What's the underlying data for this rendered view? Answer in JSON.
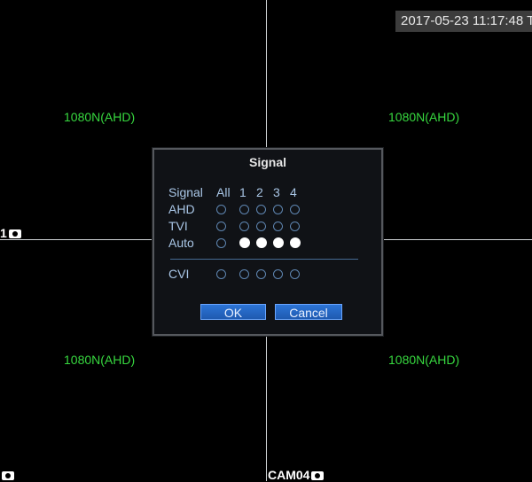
{
  "timestamp": "2017-05-23 11:17:48 T",
  "channels": [
    {
      "position": "tl",
      "resolution": "1080N(AHD)"
    },
    {
      "position": "tr",
      "resolution": "1080N(AHD)"
    },
    {
      "position": "bl",
      "resolution": "1080N(AHD)"
    },
    {
      "position": "br",
      "resolution": "1080N(AHD)"
    }
  ],
  "cam_labels": {
    "cam01": "1",
    "cam03": "",
    "cam04": "CAM04"
  },
  "dialog": {
    "title": "Signal",
    "header": {
      "label": "Signal",
      "all": "All",
      "c1": "1",
      "c2": "2",
      "c3": "3",
      "c4": "4"
    },
    "rows": [
      {
        "label": "AHD",
        "all": false,
        "c1": false,
        "c2": false,
        "c3": false,
        "c4": false
      },
      {
        "label": "TVI",
        "all": false,
        "c1": false,
        "c2": false,
        "c3": false,
        "c4": false
      },
      {
        "label": "Auto",
        "all": false,
        "c1": true,
        "c2": true,
        "c3": true,
        "c4": true
      }
    ],
    "cvi": {
      "label": "CVI",
      "all": false,
      "c1": false,
      "c2": false,
      "c3": false,
      "c4": false
    },
    "ok_label": "OK",
    "cancel_label": "Cancel"
  },
  "colors": {
    "grid_line": "#cfd3d6",
    "resolution_text": "#37d83f",
    "dialog_bg": "#101216",
    "accent_blue": "#2c74d6"
  }
}
